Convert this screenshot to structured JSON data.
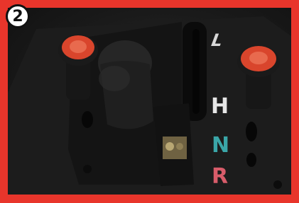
{
  "badge": {
    "number": "2"
  },
  "shift_labels": {
    "l": "L",
    "h": "H",
    "n": "N",
    "r": "R"
  },
  "colors": {
    "frame": "#e8352b",
    "knob_red": "#d9452c",
    "n_label": "#3aa6a8",
    "r_label": "#d85c6a"
  }
}
